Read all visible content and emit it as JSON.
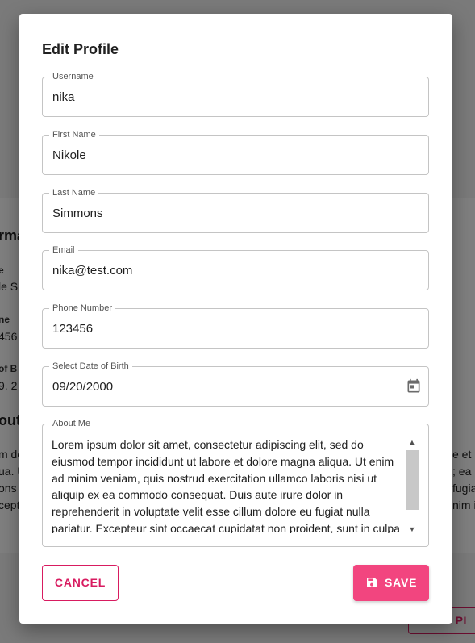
{
  "background": {
    "section_heading_1": "rma",
    "label_1": "e",
    "value_1": "le S",
    "label_2": "ne",
    "value_2": "456",
    "label_3": "of B",
    "value_3": "9. 2",
    "section_heading_2": "out",
    "para_left": "m do\nua. U\nons\ncept",
    "para_right": "e et\n; ea\nfugia\nnim i",
    "button_label": "GE PI"
  },
  "dialog": {
    "title": "Edit Profile",
    "fields": [
      {
        "label": "Username",
        "value": "nika"
      },
      {
        "label": "First Name",
        "value": "Nikole"
      },
      {
        "label": "Last Name",
        "value": "Simmons"
      },
      {
        "label": "Email",
        "value": "nika@test.com"
      },
      {
        "label": "Phone Number",
        "value": "123456"
      },
      {
        "label": "Select Date of Birth",
        "value": "09/20/2000",
        "icon": "calendar-icon"
      }
    ],
    "about": {
      "label": "About Me",
      "value": "Lorem ipsum dolor sit amet, consectetur adipiscing elit, sed do eiusmod tempor incididunt ut labore et dolore magna aliqua. Ut enim ad minim veniam, quis nostrud exercitation ullamco laboris nisi ut aliquip ex ea commodo consequat. Duis aute irure dolor in reprehenderit in voluptate velit esse cillum dolore eu fugiat nulla pariatur. Excepteur sint occaecat cupidatat non proident, sunt in culpa qui officia deserunt mollit anim id est laborum."
    },
    "cancel_label": "CANCEL",
    "save_label": "SAVE",
    "save_icon": "save-icon"
  },
  "colors": {
    "accent": "#d81b60",
    "save_button": "#f2457f"
  }
}
